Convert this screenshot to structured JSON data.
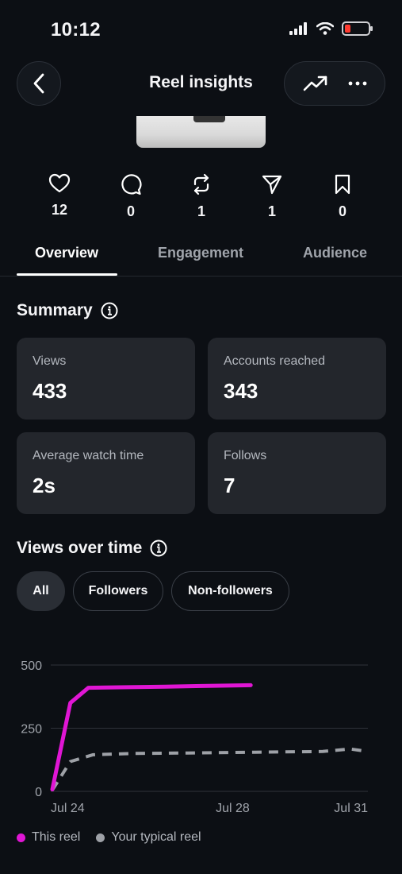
{
  "status_bar": {
    "time": "10:12"
  },
  "header": {
    "title": "Reel insights"
  },
  "stats": [
    {
      "icon": "heart-icon",
      "value": "12"
    },
    {
      "icon": "comment-icon",
      "value": "0"
    },
    {
      "icon": "repost-icon",
      "value": "1"
    },
    {
      "icon": "share-icon",
      "value": "1"
    },
    {
      "icon": "bookmark-icon",
      "value": "0"
    }
  ],
  "tabs": [
    {
      "label": "Overview",
      "active": true
    },
    {
      "label": "Engagement",
      "active": false
    },
    {
      "label": "Audience",
      "active": false
    }
  ],
  "summary": {
    "title": "Summary",
    "cards": [
      {
        "label": "Views",
        "value": "433"
      },
      {
        "label": "Accounts reached",
        "value": "343"
      },
      {
        "label": "Average watch time",
        "value": "2s"
      },
      {
        "label": "Follows",
        "value": "7"
      }
    ]
  },
  "views_over_time": {
    "title": "Views over time",
    "filters": [
      {
        "label": "All",
        "active": true
      },
      {
        "label": "Followers",
        "active": false
      },
      {
        "label": "Non-followers",
        "active": false
      }
    ]
  },
  "colors": {
    "this_reel": "#e016d4",
    "typical_reel": "#9ea1a7"
  },
  "chart_data": {
    "type": "line",
    "y_ticks": [
      "500",
      "250",
      "0"
    ],
    "x_ticks": [
      {
        "label": "Jul 24",
        "day": 0
      },
      {
        "label": "Jul 28",
        "day": 4
      },
      {
        "label": "Jul 31",
        "day": 7
      }
    ],
    "ylim": [
      0,
      500
    ],
    "xlim": [
      0,
      7
    ],
    "grid": true,
    "legend_position": "bottom-left",
    "series": [
      {
        "name": "This reel",
        "style": "solid",
        "points": [
          [
            0,
            8
          ],
          [
            0.4,
            350
          ],
          [
            0.8,
            410
          ],
          [
            1.5,
            412
          ],
          [
            2.5,
            414
          ],
          [
            3.3,
            417
          ],
          [
            4.4,
            420
          ]
        ]
      },
      {
        "name": "Your typical reel",
        "style": "dashed",
        "points": [
          [
            0,
            5
          ],
          [
            0.4,
            118
          ],
          [
            0.9,
            145
          ],
          [
            1.8,
            150
          ],
          [
            3,
            152
          ],
          [
            4.5,
            155
          ],
          [
            6,
            158
          ],
          [
            6.6,
            168
          ],
          [
            7,
            158
          ]
        ]
      }
    ]
  }
}
